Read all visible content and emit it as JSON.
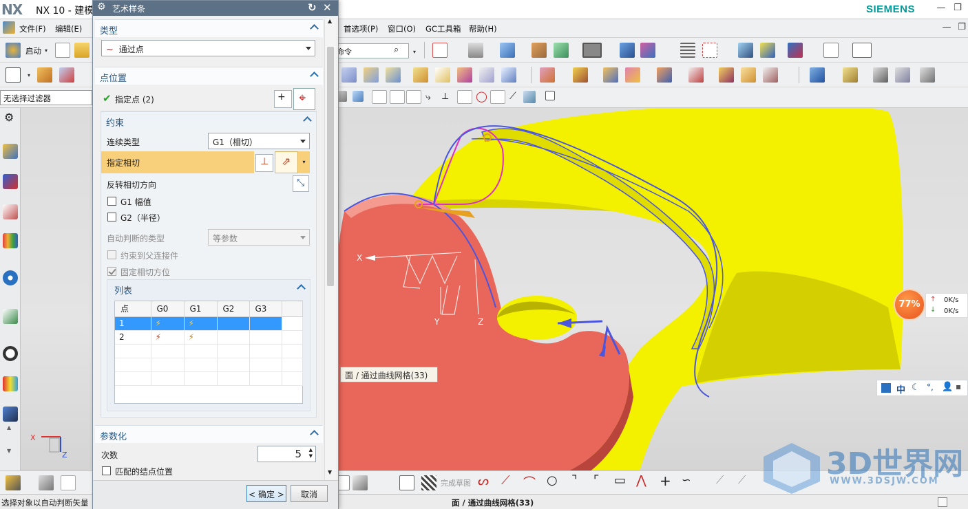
{
  "app": {
    "logo": "NX",
    "title": "NX 10 - 建模",
    "brand": "SIEMENS"
  },
  "menu": {
    "left": [
      "文件(F)",
      "编辑(E)"
    ],
    "right": [
      "首选项(P)",
      "窗口(O)",
      "GC工具箱",
      "帮助(H)"
    ]
  },
  "toolbar": {
    "start_label": "启动",
    "search_placeholder": "命令",
    "filter": "无选择过滤器",
    "complete_sketch": "完成草图"
  },
  "dialog": {
    "title": "艺术样条",
    "type_section": "类型",
    "type_value": "通过点",
    "point_section": "点位置",
    "specify_point": "指定点 (2)",
    "constraint_section": "约束",
    "continuity_label": "连续类型",
    "continuity_value": "G1（相切）",
    "specify_tangent": "指定相切",
    "reverse_tangent": "反转相切方向",
    "g1_magnitude": "G1 幅值",
    "g2_radius": "G2（半径）",
    "auto_type_label": "自动判断的类型",
    "auto_type_value": "等参数",
    "constrain_parent": "约束到父连接件",
    "fix_tangent": "固定相切方位",
    "list_section": "列表",
    "list_headers": [
      "点",
      "G0",
      "G1",
      "G2",
      "G3"
    ],
    "list_rows": [
      "1",
      "2"
    ],
    "param_section": "参数化",
    "degree_label": "次数",
    "degree_value": "5",
    "match_knots": "匹配的结点位置",
    "ok": "< 确定 >",
    "cancel": "取消"
  },
  "viewport": {
    "tooltip": "面 / 通过曲线网格(33)",
    "axis_x": "X",
    "axis_y": "Y",
    "axis_z": "Z",
    "triad_x": "X",
    "triad_z": "Z"
  },
  "netmeter": {
    "percent": "77%",
    "up": "0K/s",
    "down": "0K/s"
  },
  "ime": {
    "mode": "中"
  },
  "status": {
    "left": "选择对象以自动判断矢量",
    "center": "面 / 通过曲线网格(33)"
  },
  "watermark": {
    "text": "3D世界网",
    "url": "WWW.3DSJW.COM"
  },
  "colors": {
    "accent": "#2a6fb0",
    "highlight_row": "#3399ff",
    "tangent_row": "#f8cf7a",
    "yellow_surface": "#f6f600",
    "red_body": "#e8675b",
    "curve": "#4a55e0"
  }
}
